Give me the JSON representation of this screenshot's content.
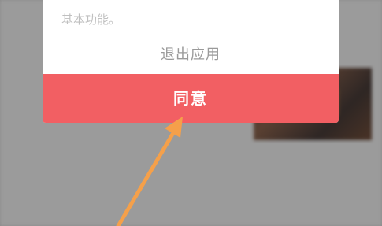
{
  "background": {
    "top_fragment": "",
    "heading_fragment": "",
    "subheading_fragment": "",
    "meta_fragment": "",
    "caret": "",
    "row_items": [
      "",
      "",
      ""
    ],
    "bottom_fragment": ""
  },
  "dialog": {
    "body_text_tail": "基本功能。",
    "exit_label": "退出应用",
    "agree_label": "同意"
  },
  "annotation": {
    "arrow_color": "#f5a04a"
  },
  "colors": {
    "agree_bg": "#f25f63",
    "overlay": "#8a8a8a"
  }
}
